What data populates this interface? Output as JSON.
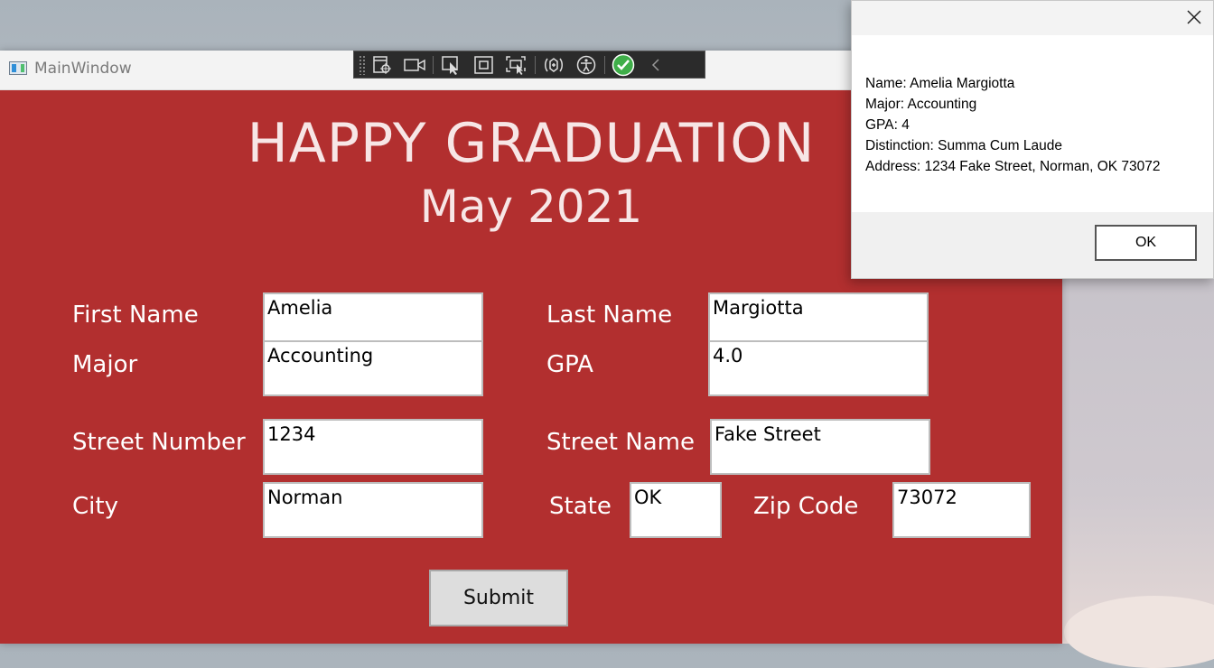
{
  "window": {
    "title": "MainWindow"
  },
  "header": {
    "title": "HAPPY GRADUATION",
    "subtitle": "May 2021"
  },
  "form": {
    "first_name_label": "First Name",
    "first_name_value": "Amelia",
    "last_name_label": "Last Name",
    "last_name_value": "Margiotta",
    "major_label": "Major",
    "major_value": "Accounting",
    "gpa_label": "GPA",
    "gpa_value": "4.0",
    "street_number_label": "Street Number",
    "street_number_value": "1234",
    "street_name_label": "Street Name",
    "street_name_value": "Fake Street",
    "city_label": "City",
    "city_value": "Norman",
    "state_label": "State",
    "state_value": "OK",
    "zip_label": "Zip Code",
    "zip_value": "73072",
    "submit_label": "Submit"
  },
  "dialog": {
    "lines": [
      "Name: Amelia Margiotta",
      "Major: Accounting",
      "GPA: 4",
      "Distinction: Summa Cum Laude",
      "Address: 1234 Fake Street, Norman, OK 73072"
    ],
    "ok_label": "OK"
  },
  "toolbar_icons": [
    "live-visual-tree-icon",
    "record-icon",
    "select-element-icon",
    "display-layout-adorners-icon",
    "track-focus-icon",
    "hot-reload-icon",
    "accessibility-icon",
    "binding-check-icon",
    "collapse-chevron-icon"
  ],
  "colors": {
    "window_background": "#b22f2f",
    "label_text": "#ffffff",
    "header_text": "#f7e6e6"
  }
}
